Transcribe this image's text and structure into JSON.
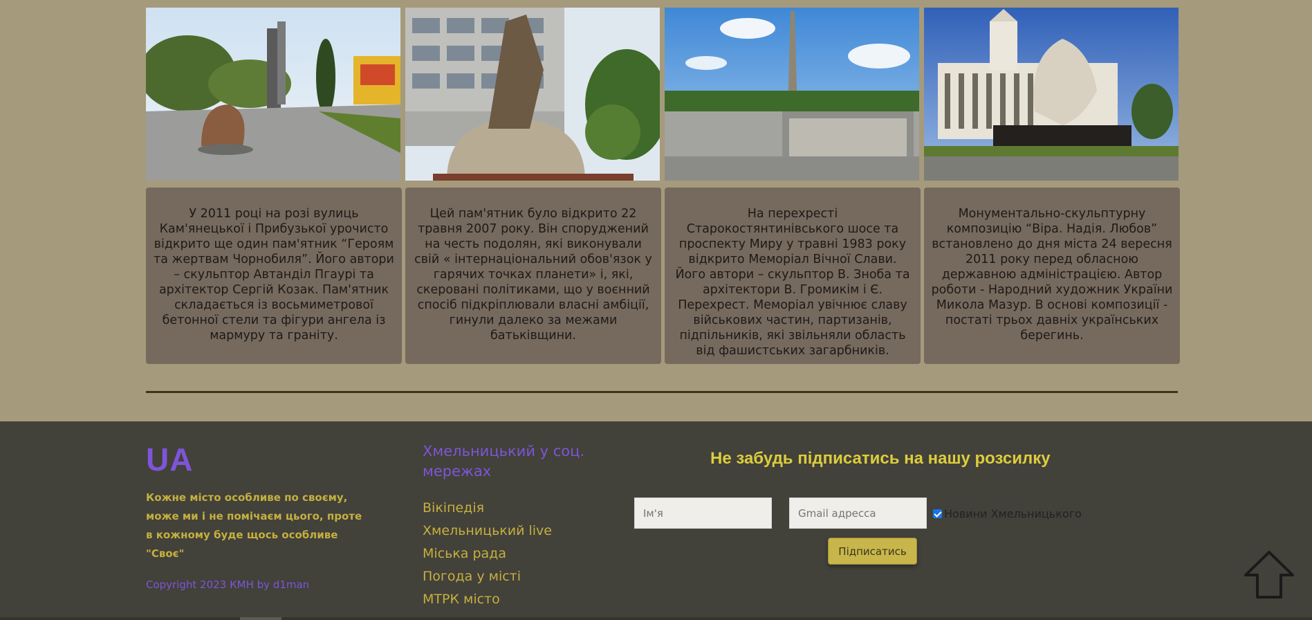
{
  "cards": [
    {
      "text": "У 2011 році на розі вулиць Кам'янецької і Прибузької урочисто відкрито ще один пам'ятник “Героям та жертвам Чорнобиля”. Його автори – скульптор Автанділ Пгаурі та архітектор Сергій Козак. Пам'ятник складається із восьмиметрової бетонної стели та фігури ангела із мармуру та граніту."
    },
    {
      "text": "Цей пам'ятник було відкрито 22 травня 2007 року. Він споруджений на честь подолян, які виконували свій « інтернаціональний обов'язок у гарячих точках планети» і, які, скеровані політиками, що у воєнний спосіб підкріплювали власні амбіції, гинули далеко за межами батьківщини."
    },
    {
      "text": "На перехресті Старокостянтинівського шосе та проспекту Миру у травні 1983 року відкрито Меморіал Вічної Слави. Його автори – скульптор В. Зноба та архітектори В. Громикім і Є. Перехрест. Меморіал увічнює славу військових частин, партизанів, підпільників, які звільняли область від фашистських загарбників."
    },
    {
      "text": "Монументально-скульптурну композицію “Віра. Надія. Любов” встановлено до дня міста 24 вересня 2011 року перед обласною державною адміністрацією. Автор роботи - Народний художник України Микола Мазур. В основі композиції - постаті трьох давніх українських берегинь."
    }
  ],
  "footer": {
    "logo": "UA",
    "tagline": "Кожне місто особливе по своєму, може ми і не помічаєм цього, проте в кожному буде щось особливе \"Своє\"",
    "copyright": "Copyright 2023 КМН by d1man",
    "social_title": "Хмельницький у соц. мережах",
    "social_links": [
      "Вікіпедія",
      "Хмельницький live",
      "Міська рада",
      "Погода у місті",
      "МТРК місто"
    ],
    "newsletter": {
      "title": "Не забудь підписатись на нашу розсилку",
      "name_placeholder": "Ім'я",
      "email_placeholder": "Gmail адресса",
      "checkbox_label": "Новини Хмельницького",
      "checkbox_checked": true,
      "button_label": "Підписатись"
    }
  },
  "colors": {
    "page_bg": "#a69a7c",
    "card_bg": "#766a5f",
    "footer_bg": "#42413a",
    "accent_purple": "#7e55d8",
    "accent_yellow": "#c5b03f"
  },
  "icons": {
    "scroll_top": "arrow-up-outline-icon"
  }
}
